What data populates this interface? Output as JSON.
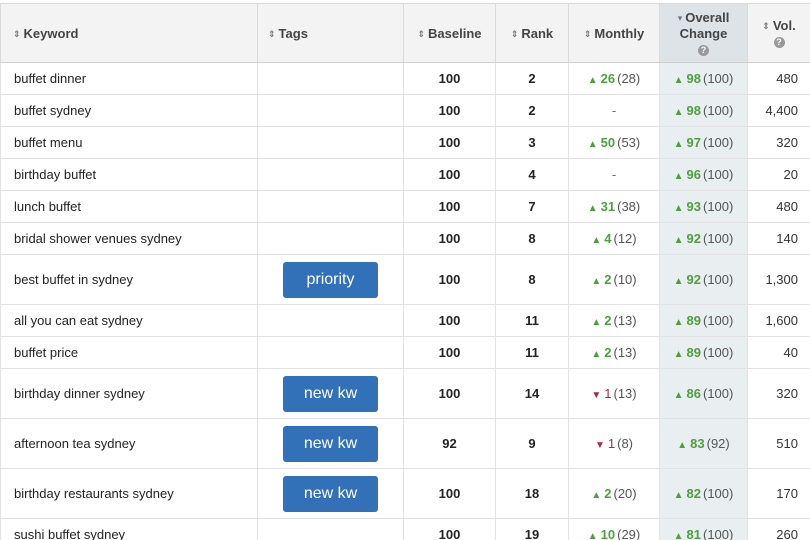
{
  "headers": {
    "keyword": "Keyword",
    "tags": "Tags",
    "baseline": "Baseline",
    "rank": "Rank",
    "monthly": "Monthly",
    "overall_line1": "Overall",
    "overall_line2": "Change",
    "volume": "Vol.",
    "help_icon": "?"
  },
  "icons": {
    "sort": "sort-arrows-icon",
    "sort_desc": "sort-desc-icon",
    "help": "help-circle-icon",
    "up": "arrow-up-icon",
    "down": "arrow-down-icon"
  },
  "colors": {
    "positive": "#4f9e3f",
    "negative": "#a6284a",
    "tag_button": "#3271b8",
    "overall_col": "#e9eef1"
  },
  "rows": [
    {
      "keyword": "buffet dinner",
      "tag": "",
      "baseline": "100",
      "rank": "2",
      "monthly_dir": "up",
      "monthly": "26",
      "monthly_prev": "(28)",
      "overall": "98",
      "overall_prev": "(100)",
      "volume": "480"
    },
    {
      "keyword": "buffet sydney",
      "tag": "",
      "baseline": "100",
      "rank": "2",
      "monthly_dir": "none",
      "monthly": "-",
      "monthly_prev": "",
      "overall": "98",
      "overall_prev": "(100)",
      "volume": "4,400"
    },
    {
      "keyword": "buffet menu",
      "tag": "",
      "baseline": "100",
      "rank": "3",
      "monthly_dir": "up",
      "monthly": "50",
      "monthly_prev": "(53)",
      "overall": "97",
      "overall_prev": "(100)",
      "volume": "320"
    },
    {
      "keyword": "birthday buffet",
      "tag": "",
      "baseline": "100",
      "rank": "4",
      "monthly_dir": "none",
      "monthly": "-",
      "monthly_prev": "",
      "overall": "96",
      "overall_prev": "(100)",
      "volume": "20"
    },
    {
      "keyword": "lunch buffet",
      "tag": "",
      "baseline": "100",
      "rank": "7",
      "monthly_dir": "up",
      "monthly": "31",
      "monthly_prev": "(38)",
      "overall": "93",
      "overall_prev": "(100)",
      "volume": "480"
    },
    {
      "keyword": "bridal shower venues sydney",
      "tag": "",
      "baseline": "100",
      "rank": "8",
      "monthly_dir": "up",
      "monthly": "4",
      "monthly_prev": "(12)",
      "overall": "92",
      "overall_prev": "(100)",
      "volume": "140"
    },
    {
      "keyword": "best buffet in sydney",
      "tag": "priority",
      "baseline": "100",
      "rank": "8",
      "monthly_dir": "up",
      "monthly": "2",
      "monthly_prev": "(10)",
      "overall": "92",
      "overall_prev": "(100)",
      "volume": "1,300"
    },
    {
      "keyword": "all you can eat sydney",
      "tag": "",
      "baseline": "100",
      "rank": "11",
      "monthly_dir": "up",
      "monthly": "2",
      "monthly_prev": "(13)",
      "overall": "89",
      "overall_prev": "(100)",
      "volume": "1,600"
    },
    {
      "keyword": "buffet price",
      "tag": "",
      "baseline": "100",
      "rank": "11",
      "monthly_dir": "up",
      "monthly": "2",
      "monthly_prev": "(13)",
      "overall": "89",
      "overall_prev": "(100)",
      "volume": "40"
    },
    {
      "keyword": "birthday dinner sydney",
      "tag": "new kw",
      "baseline": "100",
      "rank": "14",
      "monthly_dir": "down",
      "monthly": "1",
      "monthly_prev": "(13)",
      "overall": "86",
      "overall_prev": "(100)",
      "volume": "320"
    },
    {
      "keyword": "afternoon tea sydney",
      "tag": "new kw",
      "baseline": "92",
      "rank": "9",
      "monthly_dir": "down",
      "monthly": "1",
      "monthly_prev": "(8)",
      "overall": "83",
      "overall_prev": "(92)",
      "volume": "510"
    },
    {
      "keyword": "birthday restaurants sydney",
      "tag": "new kw",
      "baseline": "100",
      "rank": "18",
      "monthly_dir": "up",
      "monthly": "2",
      "monthly_prev": "(20)",
      "overall": "82",
      "overall_prev": "(100)",
      "volume": "170"
    },
    {
      "keyword": "sushi buffet sydney",
      "tag": "",
      "baseline": "100",
      "rank": "19",
      "monthly_dir": "up",
      "monthly": "10",
      "monthly_prev": "(29)",
      "overall": "81",
      "overall_prev": "(100)",
      "volume": "260"
    }
  ]
}
